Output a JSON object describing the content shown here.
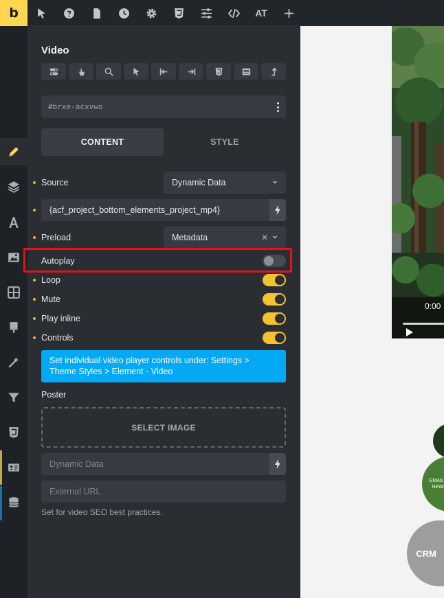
{
  "topbar": {
    "logo": "b",
    "text_tool": "AT"
  },
  "panel": {
    "title": "Video",
    "element_id": "#brxe-acxvwo",
    "tabs": [
      {
        "label": "CONTENT",
        "active": true
      },
      {
        "label": "STYLE",
        "active": false
      }
    ],
    "fields": {
      "source_label": "Source",
      "source_value": "Dynamic Data",
      "dynamic_tag": "{acf_project_bottom_elements_project_mp4}",
      "preload_label": "Preload",
      "preload_value": "Metadata",
      "autoplay_label": "Autoplay",
      "loop_label": "Loop",
      "mute_label": "Mute",
      "play_inline_label": "Play inline",
      "controls_label": "Controls"
    },
    "toggles": {
      "autoplay": false,
      "loop": true,
      "mute": true,
      "play_inline": true,
      "controls": true
    },
    "info_text": "Set individual video player controls under: Settings > Theme Styles > Element - Video",
    "poster_label": "Poster",
    "select_image_label": "SELECT IMAGE",
    "poster_dynamic_placeholder": "Dynamic Data",
    "external_url_placeholder": "External URL",
    "seo_help": "Set for video SEO best practices."
  },
  "preview": {
    "video_time": "0:00",
    "bubble_green_text": "EMAIL M NEWS",
    "bubble_grey_text": "CRM"
  },
  "colors": {
    "accent_yellow": "#ffd64f",
    "toggle_on": "#f2c230",
    "info_blue": "#03a9f4",
    "highlight_red": "#e4131a",
    "panel_bg": "#2a2d32"
  }
}
